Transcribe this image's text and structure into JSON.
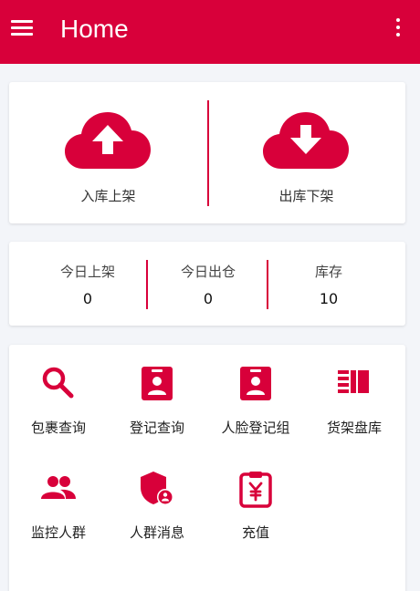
{
  "colors": {
    "accent": "#d8003a",
    "background": "#f3f5f9",
    "card": "#ffffff"
  },
  "appbar": {
    "title": "Home",
    "menu_icon": "hamburger-menu-icon",
    "more_icon": "more-vert-icon"
  },
  "io": [
    {
      "label": "入库上架",
      "icon": "cloud-upload-icon"
    },
    {
      "label": "出库下架",
      "icon": "cloud-download-icon"
    }
  ],
  "stats": [
    {
      "label": "今日上架",
      "value": "0"
    },
    {
      "label": "今日出仓",
      "value": "0"
    },
    {
      "label": "库存",
      "value": "10"
    }
  ],
  "grid": [
    {
      "label": "包裹查询",
      "icon": "search-icon"
    },
    {
      "label": "登记查询",
      "icon": "badge-icon"
    },
    {
      "label": "人脸登记组",
      "icon": "badge-icon"
    },
    {
      "label": "货架盘库",
      "icon": "shelf-list-icon"
    },
    {
      "label": "监控人群",
      "icon": "people-icon"
    },
    {
      "label": "人群消息",
      "icon": "shield-user-icon"
    },
    {
      "label": "充值",
      "icon": "yuan-clipboard-icon"
    }
  ]
}
